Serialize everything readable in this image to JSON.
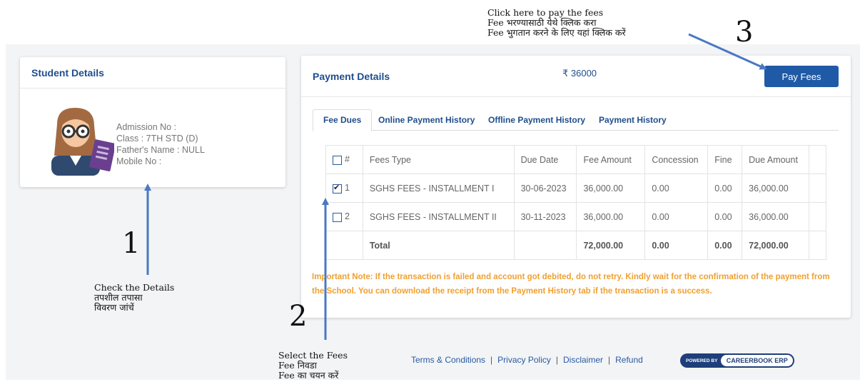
{
  "student": {
    "title": "Student Details",
    "admission": "Admission No :",
    "class": "Class : 7TH STD (D)",
    "father": "Father's Name : NULL",
    "mobile": "Mobile No :"
  },
  "payment": {
    "title": "Payment Details",
    "amount": "₹ 36000",
    "pay_button": "Pay Fees",
    "tabs": [
      "Fee Dues",
      "Online Payment History",
      "Offline Payment History",
      "Payment History"
    ],
    "active_tab": "Fee Dues",
    "table": {
      "headers": [
        "#",
        "Fees Type",
        "Due Date",
        "Fee Amount",
        "Concession",
        "Fine",
        "Due Amount"
      ],
      "rows": [
        {
          "no": "1",
          "checked": true,
          "type": "SGHS FEES - INSTALLMENT I",
          "due_date": "30-06-2023",
          "fee": "36,000.00",
          "concession": "0.00",
          "fine": "0.00",
          "due": "36,000.00"
        },
        {
          "no": "2",
          "checked": false,
          "type": "SGHS FEES - INSTALLMENT II",
          "due_date": "30-11-2023",
          "fee": "36,000.00",
          "concession": "0.00",
          "fine": "0.00",
          "due": "36,000.00"
        }
      ],
      "total": {
        "label": "Total",
        "fee": "72,000.00",
        "concession": "0.00",
        "fine": "0.00",
        "due": "72,000.00"
      }
    },
    "note": "Important Note: If the transaction is failed and account got debited, do not retry. Kindly wait for the confirmation of the payment from the School. You can download the receipt from the Payment History tab if the transaction is a success.",
    "note_color": "#f0a030"
  },
  "footer": {
    "links": [
      "Terms & Conditions",
      "Privacy Policy",
      "Disclaimer",
      "Refund"
    ],
    "powered_by": "POWERED BY",
    "brand": "CAREERBOOK ERP"
  },
  "annotations": {
    "a1_num": "1",
    "a1_text": "Check the Details\nतपशील तपासा\nविवरण जांचें",
    "a2_num": "2",
    "a2_text": "Select the Fees\nFee निवडा\nFee का चयन करें",
    "a3_num": "3",
    "a3_text": "Click here to pay the fees\nFee भरण्यासाठी येथे क्लिक करा\nFee भुगतान करने के लिए यहां क्लिक करें"
  },
  "colors": {
    "accent": "#1f5aa6",
    "heading": "#1f4e8c",
    "arrow": "#4a78c2"
  }
}
